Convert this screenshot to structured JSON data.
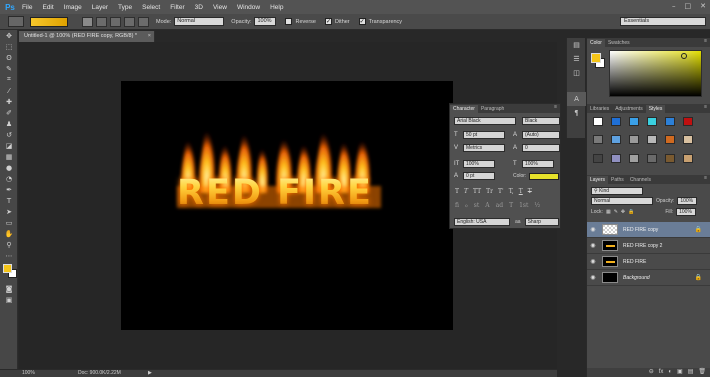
{
  "app": {
    "logo": "Ps"
  },
  "menu": [
    "File",
    "Edit",
    "Image",
    "Layer",
    "Type",
    "Select",
    "Filter",
    "3D",
    "View",
    "Window",
    "Help"
  ],
  "window_controls": [
    "–",
    "□",
    "✕"
  ],
  "options": {
    "mode_label": "Mode:",
    "mode_value": "Normal",
    "opacity_label": "Opacity:",
    "opacity_value": "100%",
    "reverse_label": "Reverse",
    "dither_label": "Dither",
    "transparency_label": "Transparency",
    "reverse_checked": false,
    "dither_checked": true,
    "transparency_checked": true,
    "workspace": "Essentials",
    "gradient_colors": [
      "#f7c72b",
      "#e0a200"
    ]
  },
  "document": {
    "tab_title": "Untitled-1 @ 100% (RED FIRE copy, RGB/8) *",
    "tab_close": "×",
    "text": "RED FIRE"
  },
  "status": {
    "zoom": "100%",
    "doc": "Doc: 900.0K/2.22M",
    "arrow": "▶"
  },
  "character_panel": {
    "tabs": [
      "Character",
      "Paragraph"
    ],
    "font_family": "Arial Black",
    "font_style": "Black",
    "size": "50 pt",
    "leading": "(Auto)",
    "kerning": "Metrics",
    "tracking": "0",
    "vscale": "100%",
    "hscale": "100%",
    "baseline": "0 pt",
    "color_label": "Color:",
    "text_color": "#e6e22a",
    "style_buttons": [
      "T",
      "T",
      "TT",
      "Tr",
      "T'",
      "T,",
      "T",
      "T"
    ],
    "opentype_buttons": [
      "fi",
      "ℴ",
      "st",
      "A",
      "ad",
      "T",
      "1st",
      "½"
    ],
    "language": "English: USA",
    "aa_label": "aa",
    "antialias": "Sharp"
  },
  "color_panel": {
    "tabs": [
      "Color",
      "Swatches"
    ],
    "foreground": "#f5c518",
    "background": "#ffffff"
  },
  "styles_panel": {
    "tabs": [
      "Libraries",
      "Adjustments",
      "Styles"
    ],
    "swatch_colors": [
      "#ffffff",
      "#1f6fd6",
      "#3aa0e8",
      "#3ad0e0",
      "#2c80d8",
      "#c01010",
      "#7a7a7a",
      "#5ea1e0",
      "#9a9a9a",
      "#b8b8b8",
      "#d06a20",
      "#d8c0a0",
      "#444444",
      "#9090c0",
      "#a0a0a0",
      "#6a6a6a",
      "#7a5a30",
      "#c8a070"
    ]
  },
  "layers_panel": {
    "tabs": [
      "Layers",
      "Paths",
      "Channels"
    ],
    "filter_kind": "Kind",
    "blend_mode": "Normal",
    "opacity_label": "Opacity:",
    "opacity": "100%",
    "lock_label": "Lock:",
    "fill_label": "Fill:",
    "fill": "100%",
    "layers": [
      {
        "name": "RED FIRE copy",
        "selected": true,
        "thumb": "checker",
        "locked": true
      },
      {
        "name": "RED FIRE copy 2",
        "selected": false,
        "thumb": "text",
        "locked": false
      },
      {
        "name": "RED FIRE",
        "selected": false,
        "thumb": "text",
        "locked": false
      },
      {
        "name": "Background",
        "selected": false,
        "thumb": "black",
        "locked": true,
        "italic": true
      }
    ],
    "footer_icons": [
      "⊖",
      "fx",
      "◐",
      "▣",
      "▤",
      "🗑"
    ]
  }
}
